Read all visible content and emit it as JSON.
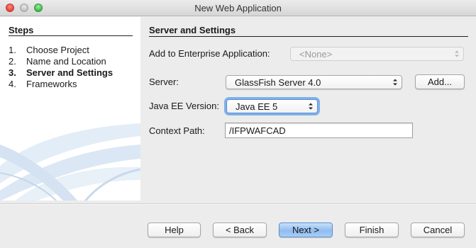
{
  "window": {
    "title": "New Web Application"
  },
  "steps": {
    "header": "Steps",
    "items": [
      {
        "num": "1.",
        "label": "Choose Project"
      },
      {
        "num": "2.",
        "label": "Name and Location"
      },
      {
        "num": "3.",
        "label": "Server and Settings",
        "current": true
      },
      {
        "num": "4.",
        "label": "Frameworks"
      }
    ]
  },
  "content": {
    "header": "Server and Settings",
    "enterprise": {
      "label": "Add to Enterprise Application:",
      "value": "<None>",
      "enabled": false
    },
    "server": {
      "label": "Server:",
      "value": "GlassFish Server 4.0",
      "add_label": "Add..."
    },
    "javaee": {
      "label": "Java EE Version:",
      "value": "Java EE 5"
    },
    "context": {
      "label": "Context Path:",
      "value": "/IFPWAFCAD"
    }
  },
  "buttons": {
    "help": "Help",
    "back": "< Back",
    "next": "Next >",
    "finish": "Finish",
    "cancel": "Cancel"
  },
  "colors": {
    "default_button": "#8fbcf0",
    "focus_ring": "#7fb1e8",
    "close": "#e0443e",
    "minimize": "#bdbdbd",
    "maximize": "#3fb34f"
  }
}
